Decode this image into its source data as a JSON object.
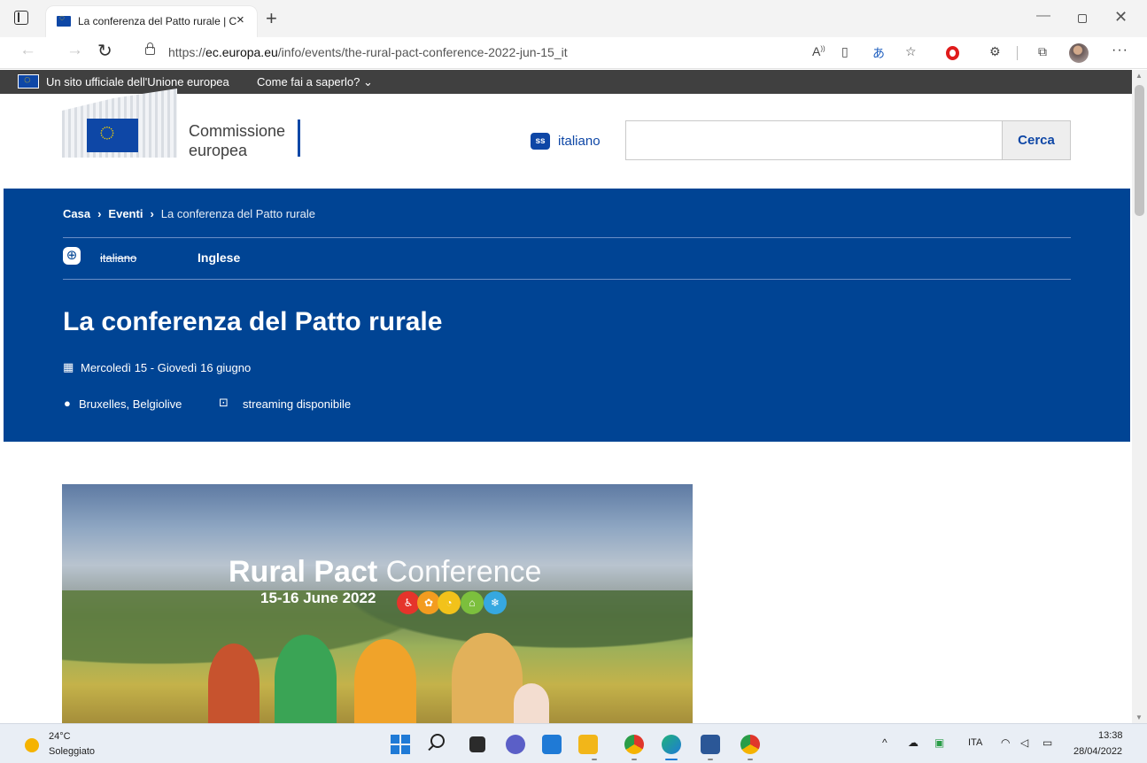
{
  "browser": {
    "tab_title": "La conferenza del Patto rurale | C",
    "tab_close": "×",
    "new_tab": "+",
    "url_protocol": "https://",
    "url_host": "ec.europa.eu",
    "url_path": "/info/events/the-rural-pact-conference-2022-jun-15_it",
    "icons": [
      "read-aloud-icon",
      "immersive-reader-icon",
      "translate-icon",
      "add-favorite-icon",
      "opera-icon",
      "extensions-icon",
      "collections-icon",
      "profile-avatar",
      "more-icon"
    ]
  },
  "eu_bar": {
    "text": "Un sito ufficiale dell'Unione europea",
    "link": "Come fai a saperlo? ⌄"
  },
  "header": {
    "logo_line1": "Commissione",
    "logo_line2": "europea",
    "language_icon_text": "ss",
    "language": "italiano",
    "search_placeholder": "",
    "search_button": "Cerca"
  },
  "hero": {
    "breadcrumb": [
      {
        "label": "Casa"
      },
      {
        "label": "Eventi"
      },
      {
        "label": "La conferenza del Patto rurale"
      }
    ],
    "breadcrumb_sep": "›",
    "lang_current": "italiano",
    "lang_alt": "Inglese",
    "title": "La conferenza del Patto rurale",
    "date": "Mercoledì 15 - Giovedì 16 giugno",
    "location": "Bruxelles, Belgiolive",
    "streaming": "streaming disponibile"
  },
  "event_image": {
    "title_bold": "Rural Pact",
    "title_light": "Conference",
    "date": "15-16 June 2022"
  },
  "taskbar": {
    "weather_temp": "24°C",
    "weather_desc": "Soleggiato",
    "tray_lang": "ITA",
    "time": "13:38",
    "date": "28/04/2022"
  },
  "colors": {
    "eu_blue": "#004494",
    "eu_yellow": "#f5d000",
    "eu_bar": "#404040"
  }
}
